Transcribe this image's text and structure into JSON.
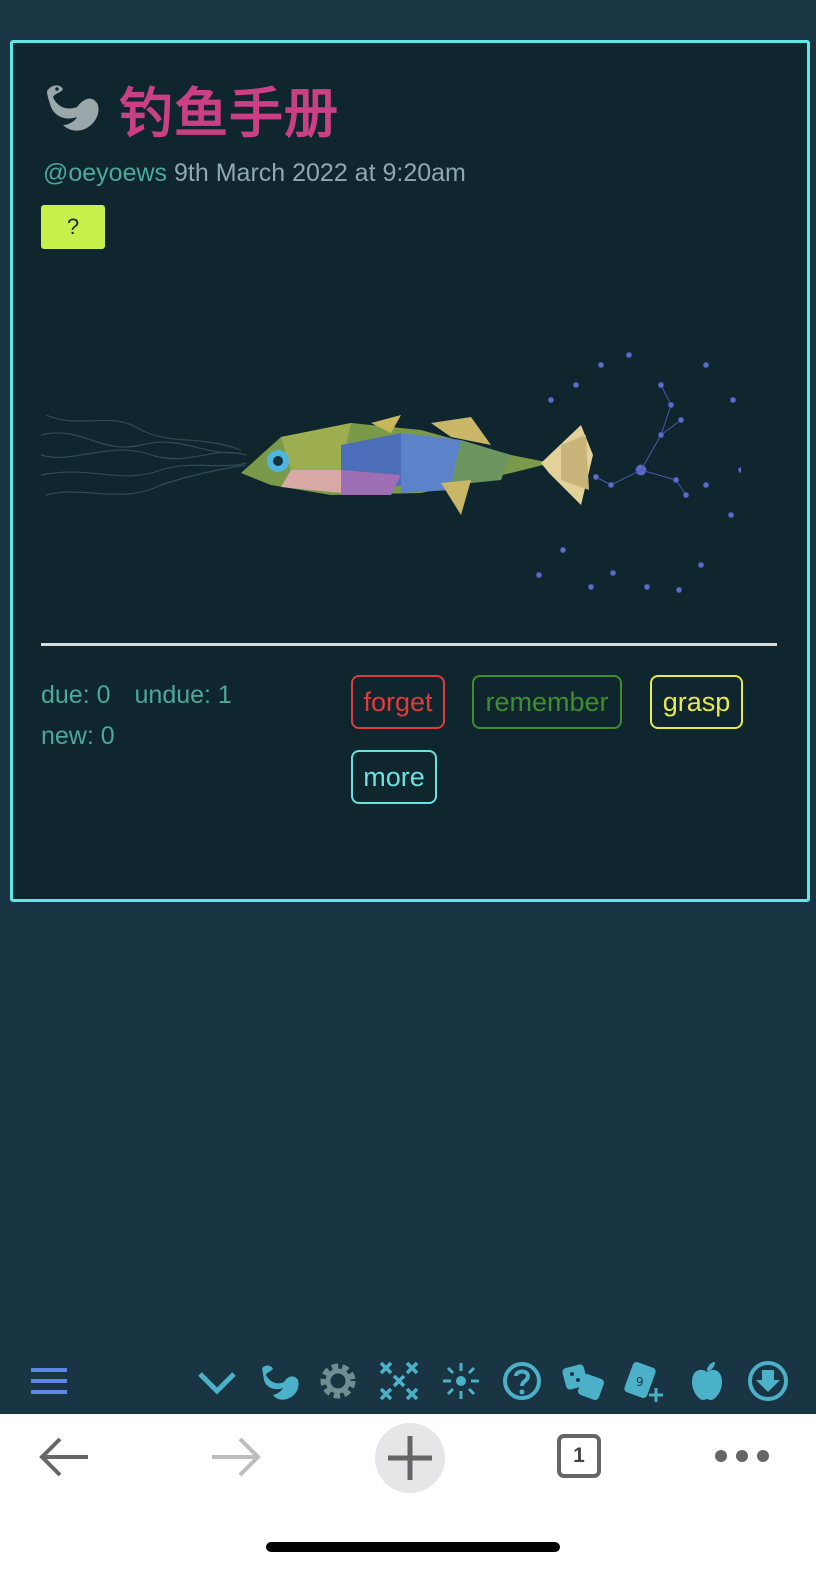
{
  "card": {
    "title": "钓鱼手册",
    "author": "@oeyoews",
    "date": "9th March 2022 at 9:20am",
    "help_button": "?"
  },
  "stats": {
    "due": "due: 0",
    "undue": "undue: 1",
    "new": "new: 0"
  },
  "review_buttons": {
    "forget": "forget",
    "remember": "remember",
    "grasp": "grasp",
    "more": "more"
  },
  "toolbar": {
    "icons": [
      "menu-icon",
      "chevron-down-icon",
      "fish-icon",
      "gear-icon",
      "close-grid-icon",
      "sun-icon",
      "help-icon",
      "dice-icon",
      "new-card-icon",
      "apple-icon",
      "download-icon"
    ]
  },
  "browser": {
    "tab_count": "1"
  },
  "colors": {
    "title": "#c94086",
    "accent": "#5fe6e6",
    "help_button_bg": "#c8ef4a",
    "forget": "#e03b3b",
    "remember": "#3e8e2e",
    "grasp": "#e9e94d",
    "more": "#6ee0e0",
    "toolbar_icon": "#4bb1c9"
  }
}
